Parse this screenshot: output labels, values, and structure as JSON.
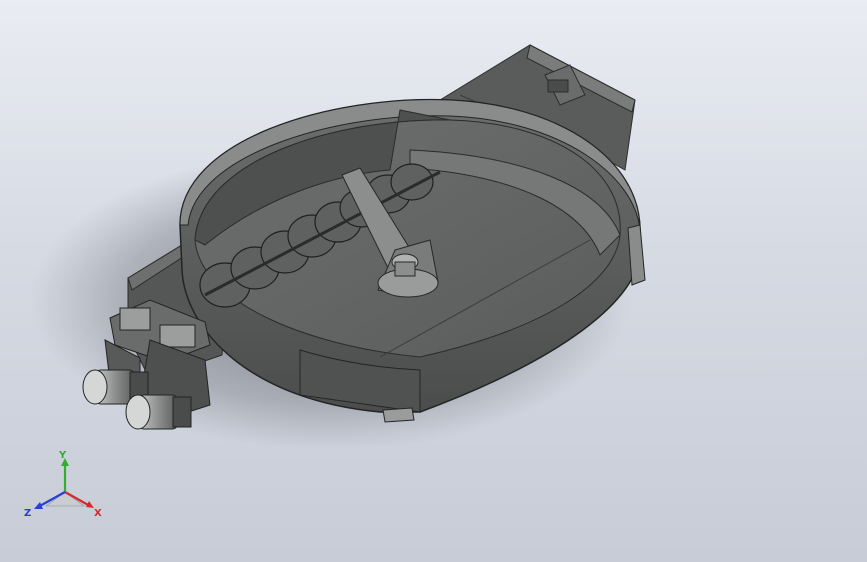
{
  "triad": {
    "x_label": "X",
    "y_label": "Y",
    "z_label": "Z",
    "x_color": "#d62a2a",
    "y_color": "#2fae2f",
    "z_color": "#2a3fd6"
  },
  "colors": {
    "background_top": "#e9ecf2",
    "background_bottom": "#c7ccd7",
    "model_dark": "#3d3f3f",
    "model_mid": "#5c5e5e",
    "model_light": "#7f8181"
  }
}
